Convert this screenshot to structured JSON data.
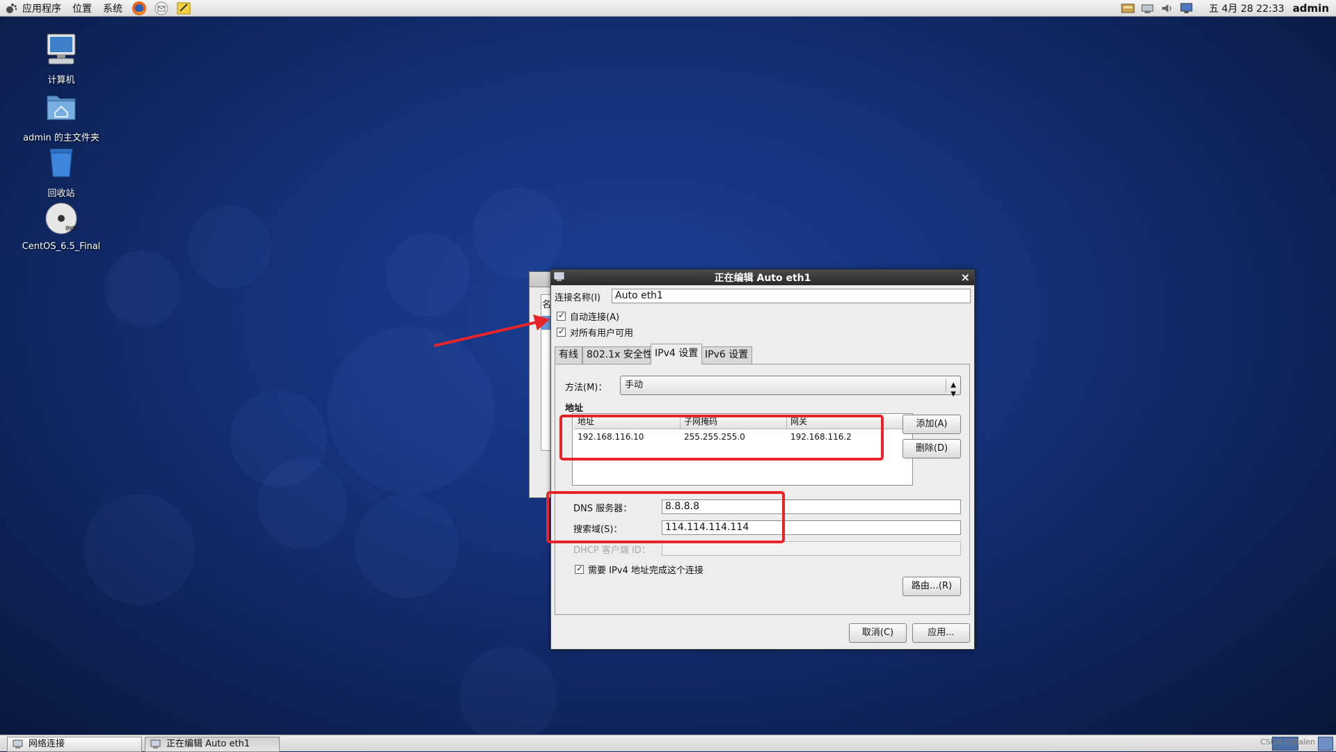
{
  "top_panel": {
    "menus": [
      "应用程序",
      "位置",
      "系统"
    ],
    "clock": "五 4月 28 22:33",
    "user": "admin",
    "launchers": [
      "firefox-icon",
      "mail-icon",
      "notes-icon"
    ],
    "tray_icons": [
      "update-icon",
      "network-icon",
      "volume-icon",
      "display-icon"
    ]
  },
  "desktop": {
    "icons": [
      {
        "name": "computer-icon",
        "label": "计算机"
      },
      {
        "name": "home-folder-icon",
        "label": "admin 的主文件夹"
      },
      {
        "name": "trash-icon",
        "label": "回收站"
      },
      {
        "name": "dvd-icon",
        "label": "CentOS_6.5_Final"
      }
    ]
  },
  "bg_window": {
    "label_fragment": "名"
  },
  "dialog": {
    "title": "正在编辑 Auto eth1",
    "close": "×",
    "conn_name_label": "连接名称(I)",
    "conn_name_value": "Auto eth1",
    "auto_connect": "自动连接(A)",
    "all_users": "对所有用户可用",
    "tabs": [
      "有线",
      "802.1x 安全性",
      "IPv4 设置",
      "IPv6 设置"
    ],
    "method_label": "方法(M)：",
    "method_value": "手动",
    "address_section": "地址",
    "table_headers": [
      "地址",
      "子网掩码",
      "网关"
    ],
    "table_rows": [
      [
        "192.168.116.10",
        "255.255.255.0",
        "192.168.116.2"
      ]
    ],
    "add_button": "添加(A)",
    "delete_button": "删除(D)",
    "dns_label": "DNS 服务器：",
    "dns_value": "8.8.8.8",
    "search_label": "搜索域(S)：",
    "search_value": "114.114.114.114",
    "dhcp_label": "DHCP 客户端 ID：",
    "require_ipv4": "需要 IPv4 地址完成这个连接",
    "routes_button": "路由…(R)",
    "cancel_button": "取消(C)",
    "apply_button": "应用..."
  },
  "taskbar": {
    "tasks": [
      "网络连接",
      "正在编辑 Auto eth1"
    ],
    "watermark": "CSDN @Malen"
  },
  "colors": {
    "annotation_red": "#e9232a",
    "desktop_blue": "#143179",
    "titlebar": "#2a2a2a"
  }
}
